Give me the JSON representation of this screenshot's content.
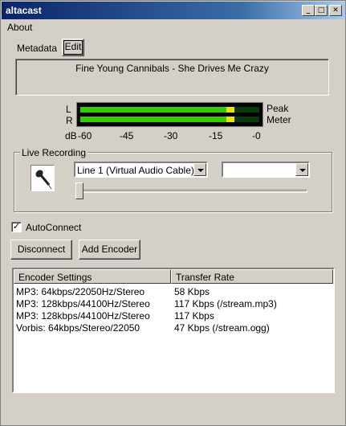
{
  "window": {
    "title": "altacast"
  },
  "titlebar_buttons": {
    "minimize": "_",
    "maximize": "□",
    "close": "✕"
  },
  "menu": {
    "about": "About"
  },
  "metadata": {
    "label": "Metadata",
    "edit_button": "Edit",
    "now_playing": "Fine Young Cannibals - She Drives Me Crazy"
  },
  "meter": {
    "left_label": "L",
    "right_label": "R",
    "peak_label": "Peak",
    "meter_label": "Meter",
    "db_label": "dB",
    "ticks": [
      "-60",
      "-45",
      "-30",
      "-15",
      "-0"
    ],
    "left_level": 0.86,
    "right_level": 0.86,
    "colors": {
      "green": "#33cc00",
      "yellow": "#e6e600",
      "background": "#000000"
    }
  },
  "live_recording": {
    "title": "Live Recording",
    "microphone_icon": "microphone-icon",
    "input_device": "Line 1 (Virtual Audio Cable)",
    "second_select": "",
    "volume_level": 0.0
  },
  "autoconnect": {
    "label": "AutoConnect",
    "checked": true,
    "check_glyph": "✓"
  },
  "buttons": {
    "disconnect": "Disconnect",
    "add_encoder": "Add Encoder"
  },
  "encoders": {
    "columns": [
      "Encoder Settings",
      "Transfer Rate"
    ],
    "rows": [
      [
        "MP3: 64kbps/22050Hz/Stereo",
        "58 Kbps"
      ],
      [
        "MP3: 128kbps/44100Hz/Stereo",
        "117 Kbps (/stream.mp3)"
      ],
      [
        "MP3: 128kbps/44100Hz/Stereo",
        "117 Kbps"
      ],
      [
        "Vorbis: 64kbps/Stereo/22050",
        "47 Kbps (/stream.ogg)"
      ]
    ]
  }
}
